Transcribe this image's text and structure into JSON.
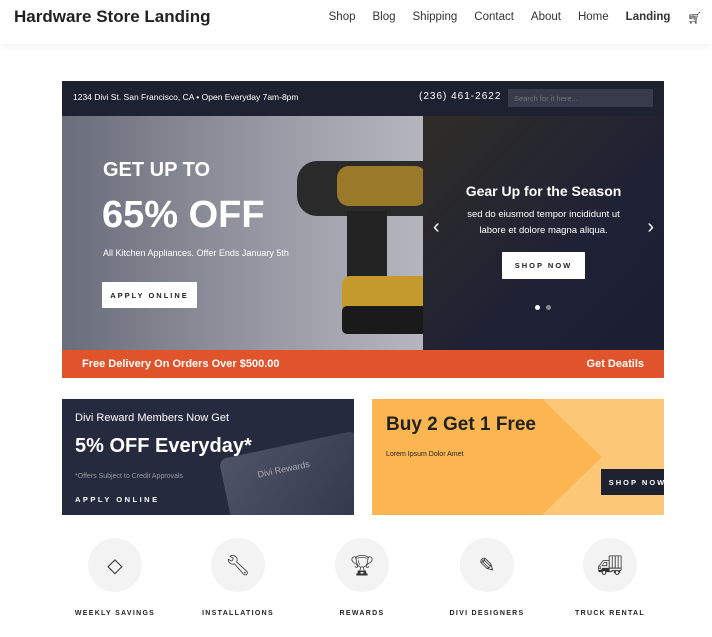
{
  "header": {
    "title": "Hardware Store Landing",
    "nav": [
      "Shop",
      "Blog",
      "Shipping",
      "Contact",
      "About",
      "Home",
      "Landing"
    ],
    "cart_icon": "cart-icon"
  },
  "topbar": {
    "address": "1234 Divi St. San Francisco, CA • Open Everyday 7am-8pm",
    "phone": "(236) 461-2622",
    "search_placeholder": "Search for it here..."
  },
  "hero": {
    "line1": "GET UP TO",
    "line2": "65% OFF",
    "line3": "All Kitchen Appliances. Offer Ends January 5th",
    "button": "APPLY ONLINE"
  },
  "slider": {
    "title": "Gear Up for the Season",
    "text": "sed do eiusmod tempor incididunt ut labore et dolore magna aliqua.",
    "button": "SHOP NOW",
    "slides": 2,
    "active": 1
  },
  "delivery": {
    "text": "Free Delivery On Orders Over $500.00",
    "link": "Get Deatils"
  },
  "rewards": {
    "line1": "Divi Reward Members Now Get",
    "line2": "5% OFF Everyday*",
    "note": "*Offers Subject to Credit Approvals",
    "button": "APPLY ONLINE",
    "card_label": "Divi Rewards"
  },
  "promo": {
    "title": "Buy 2 Get 1 Free",
    "text": "Lorem Ipsum Dolor Amet",
    "button": "SHOP NOW"
  },
  "features": [
    {
      "label": "WEEKLY SAVINGS",
      "icon": "tag-icon"
    },
    {
      "label": "INSTALLATIONS",
      "icon": "wrench-icon"
    },
    {
      "label": "REWARDS",
      "icon": "trophy-icon"
    },
    {
      "label": "DIVI DESIGNERS",
      "icon": "tools-icon"
    },
    {
      "label": "TRUCK RENTAL",
      "icon": "truck-icon"
    }
  ],
  "colors": {
    "dark": "#1e2130",
    "orange": "#e0542b",
    "yellow": "#fbb652"
  }
}
